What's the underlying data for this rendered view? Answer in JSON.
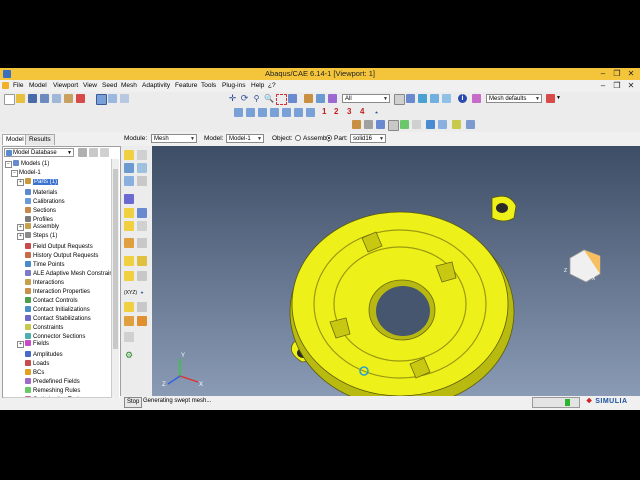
{
  "window": {
    "title": "Abaqus/CAE 6.14-1 [Viewport: 1]"
  },
  "menubar": [
    "File",
    "Model",
    "Viewport",
    "View",
    "Seed",
    "Mesh",
    "Adaptivity",
    "Feature",
    "Tools",
    "Plug-ins",
    "Help",
    "¿?"
  ],
  "toolbar": {
    "selection_filter": "All",
    "mesh_defaults": "Mesh defaults",
    "step_numbers": [
      "1",
      "2",
      "3",
      "4"
    ]
  },
  "context": {
    "module_label": "Module:",
    "module_value": "Mesh",
    "model_label": "Model:",
    "model_value": "Model-1",
    "object_label": "Object:",
    "assembly_label": "Assembly",
    "part_label": "Part:",
    "part_value": "solid16"
  },
  "tabs": [
    "Model",
    "Results"
  ],
  "tree": {
    "header": "Model Database",
    "root": "Models (1)",
    "model": "Model-1",
    "items": [
      {
        "label": "Parts (1)",
        "expand": true,
        "icon": "parts-icon",
        "color": "#c89a3a"
      },
      {
        "label": "Materials",
        "expand": false,
        "icon": "materials-icon",
        "color": "#5a8ad0"
      },
      {
        "label": "Calibrations",
        "expand": false,
        "icon": "calibrations-icon",
        "color": "#6a9ad8"
      },
      {
        "label": "Sections",
        "expand": false,
        "icon": "sections-icon",
        "color": "#c88a4a"
      },
      {
        "label": "Profiles",
        "expand": false,
        "icon": "profiles-icon",
        "color": "#7a7a7a"
      },
      {
        "label": "Assembly",
        "expand": true,
        "icon": "assembly-icon",
        "color": "#c8a04a"
      },
      {
        "label": "Steps (1)",
        "expand": true,
        "icon": "steps-icon",
        "color": "#8a8a8a"
      },
      {
        "label": "Field Output Requests",
        "expand": false,
        "icon": "field-output-icon",
        "color": "#c84a4a"
      },
      {
        "label": "History Output Requests",
        "expand": false,
        "icon": "history-output-icon",
        "color": "#c86a4a"
      },
      {
        "label": "Time Points",
        "expand": false,
        "icon": "time-points-icon",
        "color": "#4a8ac8"
      },
      {
        "label": "ALE Adaptive Mesh Constraints",
        "expand": false,
        "icon": "ale-icon",
        "color": "#7a7ac8"
      },
      {
        "label": "Interactions",
        "expand": false,
        "icon": "interactions-icon",
        "color": "#c8a04a"
      },
      {
        "label": "Interaction Properties",
        "expand": false,
        "icon": "interaction-properties-icon",
        "color": "#c8904a"
      },
      {
        "label": "Contact Controls",
        "expand": false,
        "icon": "contact-controls-icon",
        "color": "#4aa04a"
      },
      {
        "label": "Contact Initializations",
        "expand": false,
        "icon": "contact-init-icon",
        "color": "#4a90c8"
      },
      {
        "label": "Contact Stabilizations",
        "expand": false,
        "icon": "contact-stab-icon",
        "color": "#6a6ac8"
      },
      {
        "label": "Constraints",
        "expand": false,
        "icon": "constraints-icon",
        "color": "#c8c84a"
      },
      {
        "label": "Connector Sections",
        "expand": false,
        "icon": "connector-icon",
        "color": "#4ab0b0"
      },
      {
        "label": "Fields",
        "expand": true,
        "icon": "fields-icon",
        "color": "#c84ac8"
      },
      {
        "label": "Amplitudes",
        "expand": false,
        "icon": "amplitudes-icon",
        "color": "#4a6ac8"
      },
      {
        "label": "Loads",
        "expand": false,
        "icon": "loads-icon",
        "color": "#c84a4a"
      },
      {
        "label": "BCs",
        "expand": false,
        "icon": "bcs-icon",
        "color": "#e0a020"
      },
      {
        "label": "Predefined Fields",
        "expand": false,
        "icon": "predefined-icon",
        "color": "#a06ac8"
      },
      {
        "label": "Remeshing Rules",
        "expand": false,
        "icon": "remeshing-icon",
        "color": "#6ac86a"
      },
      {
        "label": "Optimization Tasks",
        "expand": false,
        "icon": "optimization-icon",
        "color": "#c86a9a"
      }
    ]
  },
  "status": {
    "stop_label": "Stop",
    "message": "Generating swept mesh...",
    "progress": 0.72,
    "brand": "SIMULIA"
  },
  "viewport": {
    "part_color": "#eef01a",
    "triad_labels": [
      "Y",
      "Z",
      "X"
    ]
  }
}
